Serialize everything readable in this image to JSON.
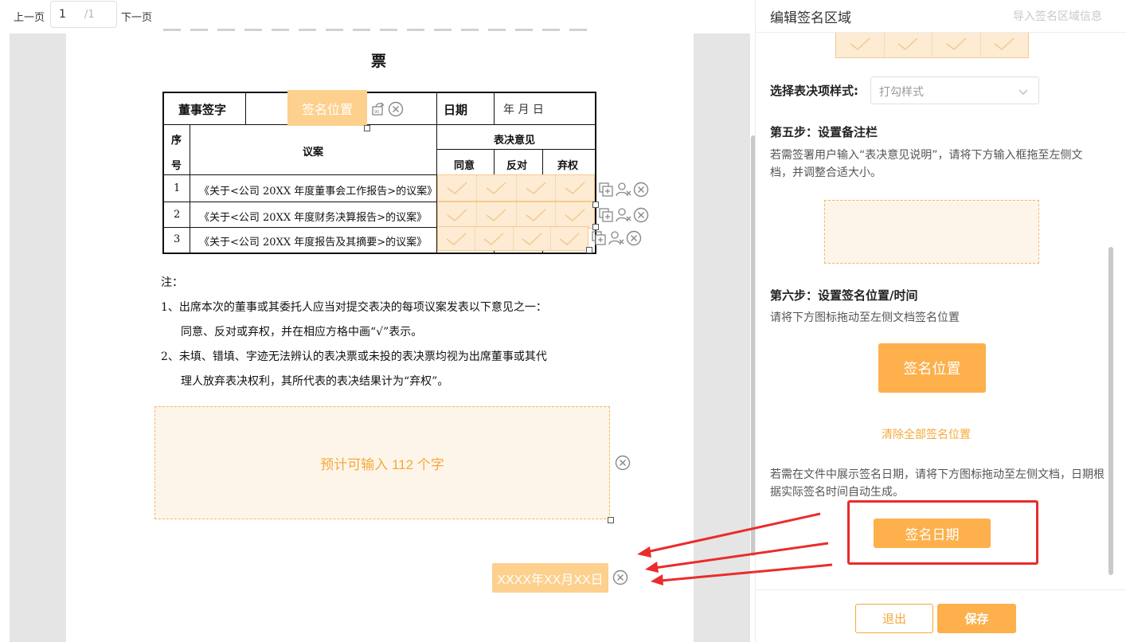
{
  "pager": {
    "prev": "上一页",
    "next": "下一页",
    "current": "1",
    "total": "/1"
  },
  "document": {
    "title": "票",
    "table": {
      "signer_label": "董事签字",
      "date_label": "日期",
      "date_placeholder": "年    月    日",
      "col_no_1": "序",
      "col_no_2": "号",
      "col_proposal": "议案",
      "col_opinion": "表决意见",
      "opt_agree": "同意",
      "opt_against": "反对",
      "opt_abstain": "弃权",
      "rows": [
        {
          "no": "1",
          "text": "《关于<公司 20XX 年度董事会工作报告>的议案》"
        },
        {
          "no": "2",
          "text": "《关于<公司 20XX 年度财务决算报告>的议案》"
        },
        {
          "no": "3",
          "text": "《关于<公司 20XX 年度报告及其摘要>的议案》"
        }
      ]
    },
    "signature_field": "签名位置",
    "notes": {
      "head": "注：",
      "n1a": "1、出席本次的董事或其委托人应当对提交表决的每项议案发表以下意见之一：",
      "n1b": "同意、反对或弃权，并在相应方格中画“√”表示。",
      "n2a": "2、未填、错填、字迹无法辨认的表决票或未投的表决票均视为出席董事或其代",
      "n2b": "理人放弃表决权利，其所代表的表决结果计为“弃权”。"
    },
    "remark_field": "预计可输入 112 个字",
    "date_field": "XXXX年XX月XX日"
  },
  "panel": {
    "title": "编辑签名区域",
    "import": "导入签名区域信息",
    "style_label": "选择表决项样式:",
    "style_value": "打勾样式",
    "step5_title": "第五步：设置备注栏",
    "step5_desc": "若需签署用户输入“表决意见说明”，请将下方输入框拖至左侧文档，并调整合适大小。",
    "step6_title": "第六步：设置签名位置/时间",
    "step6_desc": "请将下方图标拖动至左侧文档签名位置",
    "signature_button": "签名位置",
    "clear_all": "清除全部签名位置",
    "date_desc": "若需在文件中展示签名日期，请将下方图标拖动至左侧文档，日期根据实际签名时间自动生成。",
    "date_button": "签名日期",
    "exit": "退出",
    "save": "保存"
  },
  "colors": {
    "accent": "#fdb04c",
    "accent_light": "#fdd08d",
    "highlight_red": "#ea2c2c"
  }
}
